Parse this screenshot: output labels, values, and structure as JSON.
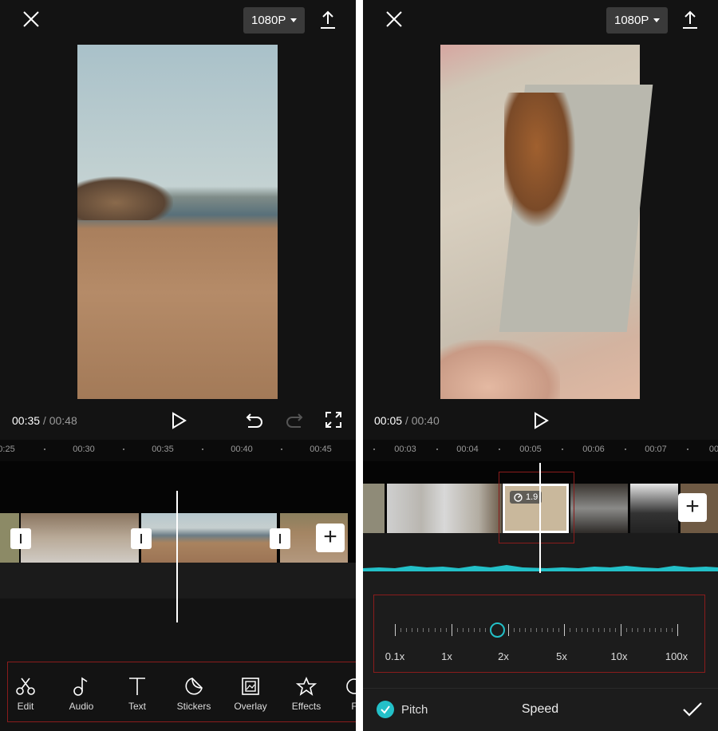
{
  "left": {
    "resolution": "1080P",
    "time_current": "00:35",
    "time_total": "00:48",
    "ruler": [
      "0:25",
      "00:30",
      "00:35",
      "00:40",
      "00:45"
    ],
    "toolbar": [
      {
        "label": "Edit",
        "icon": "scissors-icon"
      },
      {
        "label": "Audio",
        "icon": "music-note-icon"
      },
      {
        "label": "Text",
        "icon": "text-icon"
      },
      {
        "label": "Stickers",
        "icon": "sticker-icon"
      },
      {
        "label": "Overlay",
        "icon": "overlay-icon"
      },
      {
        "label": "Effects",
        "icon": "effects-star-icon"
      },
      {
        "label": "F",
        "icon": "filter-icon"
      }
    ]
  },
  "right": {
    "resolution": "1080P",
    "time_current": "00:05",
    "time_total": "00:40",
    "ruler": [
      "00:03",
      "00:04",
      "00:05",
      "00:06",
      "00:07",
      "00"
    ],
    "clip_speed_badge": "1.9",
    "speed_scale": [
      "0.1x",
      "1x",
      "2x",
      "5x",
      "10x",
      "100x"
    ],
    "speed_value": "1.9x",
    "pitch_label": "Pitch",
    "pitch_checked": true,
    "panel_title": "Speed"
  },
  "colors": {
    "accent": "#23c0c8",
    "background": "#131313",
    "highlight_box": "#8a1c1c"
  }
}
